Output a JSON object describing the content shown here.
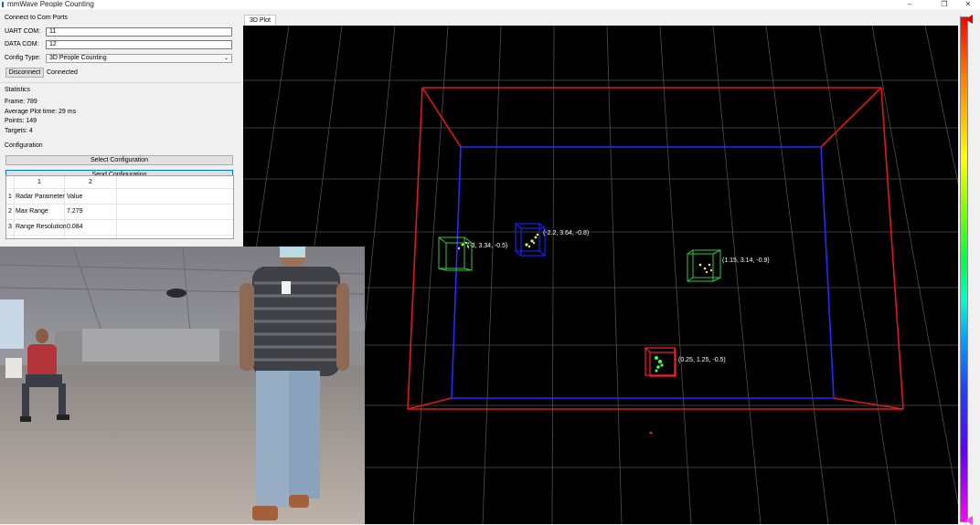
{
  "window": {
    "title": "mmWave People Counting",
    "minimize": "–",
    "restore": "❐",
    "close": "✕"
  },
  "connect": {
    "heading": "Connect to Com Ports",
    "uart_label": "UART COM:",
    "uart_value": "11",
    "data_label": "DATA COM:",
    "data_value": "12",
    "config_type_label": "Config Type:",
    "config_type_value": "3D People Counting",
    "disconnect_button": "Disconnect",
    "status": "Connected"
  },
  "statistics": {
    "heading": "Statistics",
    "frame": "Frame: 789",
    "plot_time": "Average Plot time: 29 ms",
    "points": "Points: 149",
    "targets": "Targets: 4"
  },
  "configuration": {
    "heading": "Configuration",
    "select_button": "Select Configuration",
    "send_button": "Send Configuration",
    "table": {
      "col_headers": [
        "1",
        "2"
      ],
      "rows": [
        {
          "num": "1",
          "param": "Radar Parameter",
          "value": "Value"
        },
        {
          "num": "2",
          "param": "Max Range",
          "value": "7.279"
        },
        {
          "num": "3",
          "param": "Range Resolution",
          "value": "0.084"
        }
      ]
    }
  },
  "plot": {
    "tab_label": "3D Plot",
    "targets": [
      {
        "label": "(-3, 3.34, -0.5)",
        "color": "#2ecc40"
      },
      {
        "label": "(-2.2, 3.64, -0.8)",
        "color": "#1a1aff"
      },
      {
        "label": "(1.15, 3.14, -0.9)",
        "color": "#2ecc40"
      },
      {
        "label": "(0.25, 1.25, -0.5)",
        "color": "#ff2020"
      }
    ],
    "boundary_outer_color": "#e01818",
    "boundary_inner_color": "#2828ff"
  },
  "colors": {
    "accent": "#0078d7",
    "plot_bg": "#000000"
  }
}
